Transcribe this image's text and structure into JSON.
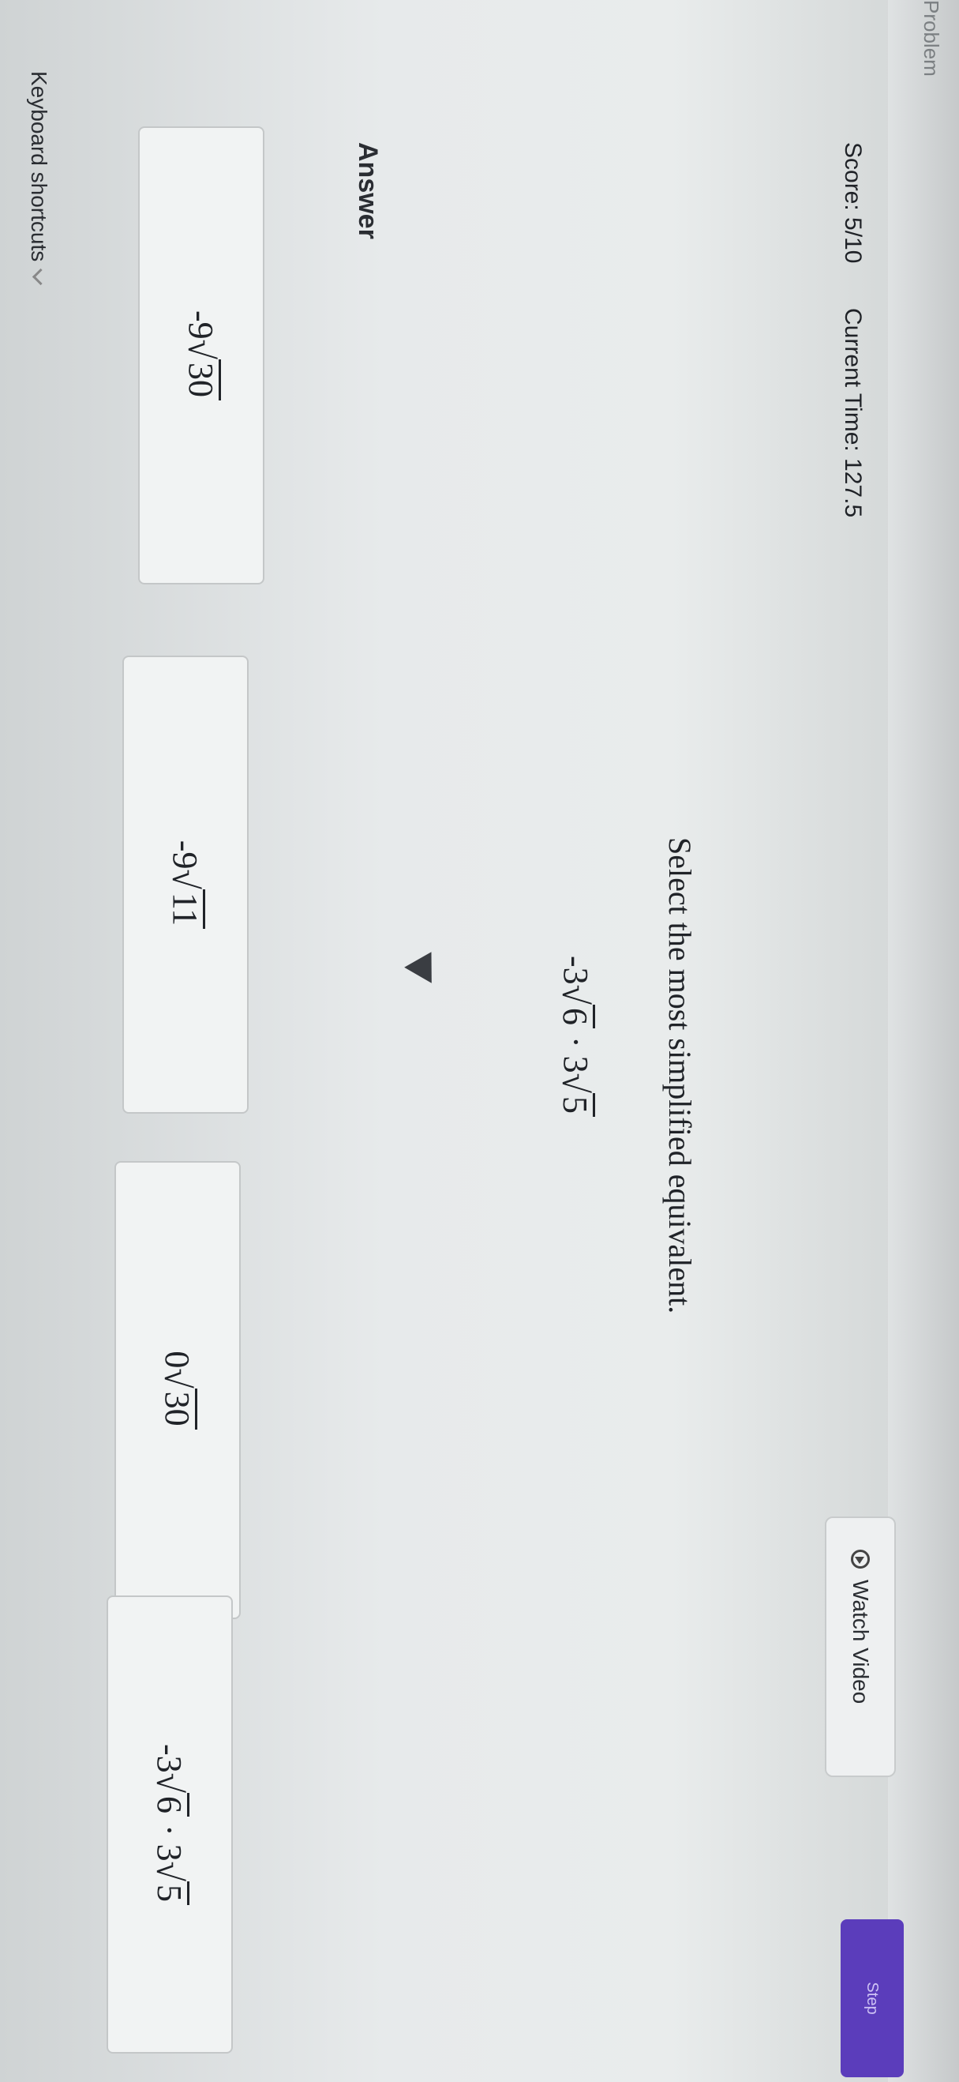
{
  "header": {
    "top_label": "Problem",
    "score": "Score: 5/10",
    "current_time": "Current Time: 127.5",
    "watch_video_label": "Watch Video",
    "step_label": "Step"
  },
  "question": {
    "prompt": "Select the most simplified equivalent.",
    "expression": {
      "coef1": "-3",
      "rad1": "6",
      "operator": "·",
      "coef2": "3",
      "rad2": "5"
    }
  },
  "answer": {
    "label": "Answer",
    "choices": [
      {
        "coef": "-9",
        "rad": "30"
      },
      {
        "coef": "-9",
        "rad": "11"
      },
      {
        "coef": "0",
        "rad": "30"
      },
      {
        "coef1": "-3",
        "rad1": "6",
        "operator": "·",
        "coef2": "3",
        "rad2": "5"
      }
    ]
  },
  "footer": {
    "keyboard_shortcuts_label": "Keyboard shortcuts"
  },
  "icons": [
    "play-circle-icon",
    "chevron-down-icon",
    "mouse-cursor-icon"
  ]
}
